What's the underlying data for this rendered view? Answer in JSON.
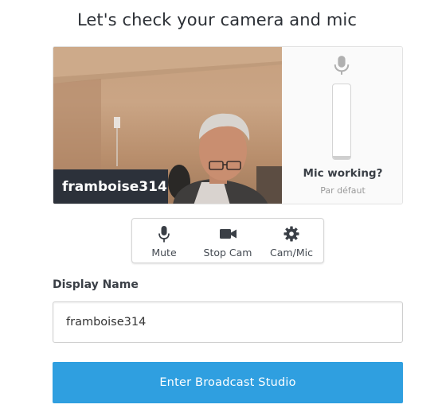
{
  "header": {
    "title": "Let's check your camera and mic"
  },
  "preview": {
    "participant_name": "framboise314",
    "mic": {
      "status": "Mic working?",
      "device": "Par défaut",
      "level_fraction": 0.04
    }
  },
  "controls": [
    {
      "label": "Mute",
      "icon": "microphone-icon"
    },
    {
      "label": "Stop Cam",
      "icon": "video-camera-icon"
    },
    {
      "label": "Cam/Mic",
      "icon": "gear-icon"
    }
  ],
  "form": {
    "display_name_label": "Display Name",
    "display_name_value": "framboise314"
  },
  "actions": {
    "enter_label": "Enter Broadcast Studio"
  },
  "colors": {
    "primary_button": "#2f9fe0",
    "name_tag_bg": "#2c313a",
    "icon_gray": "#b0b0b0",
    "control_icon": "#3a3f46"
  }
}
